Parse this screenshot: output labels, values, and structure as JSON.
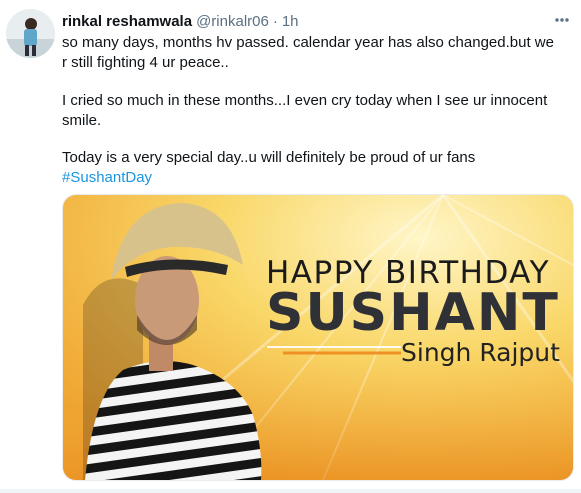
{
  "user": {
    "display_name": "rinkal reshamwala",
    "handle": "@rinkalr06",
    "separator": "·",
    "timestamp": "1h"
  },
  "tweet": {
    "paragraph1": "so many days, months hv passed. calendar year has also changed.but we r still fighting 4 ur peace..",
    "paragraph2": "I cried so much in these months...I even  cry today when I see ur innocent smile.",
    "paragraph3": "Today is a very special day..u will definitely be proud of ur fans",
    "hashtag": "#SushantDay"
  },
  "media": {
    "line1": "HAPPY BIRTHDAY",
    "line2": "SUSHANT",
    "line3": "Singh Rajput"
  },
  "icons": {
    "more": "more-options-icon"
  },
  "colors": {
    "link": "#1b95e0",
    "secondary_text": "#5b7083",
    "banner_yellow": "#f6c343",
    "banner_orange": "#f19a2a"
  }
}
